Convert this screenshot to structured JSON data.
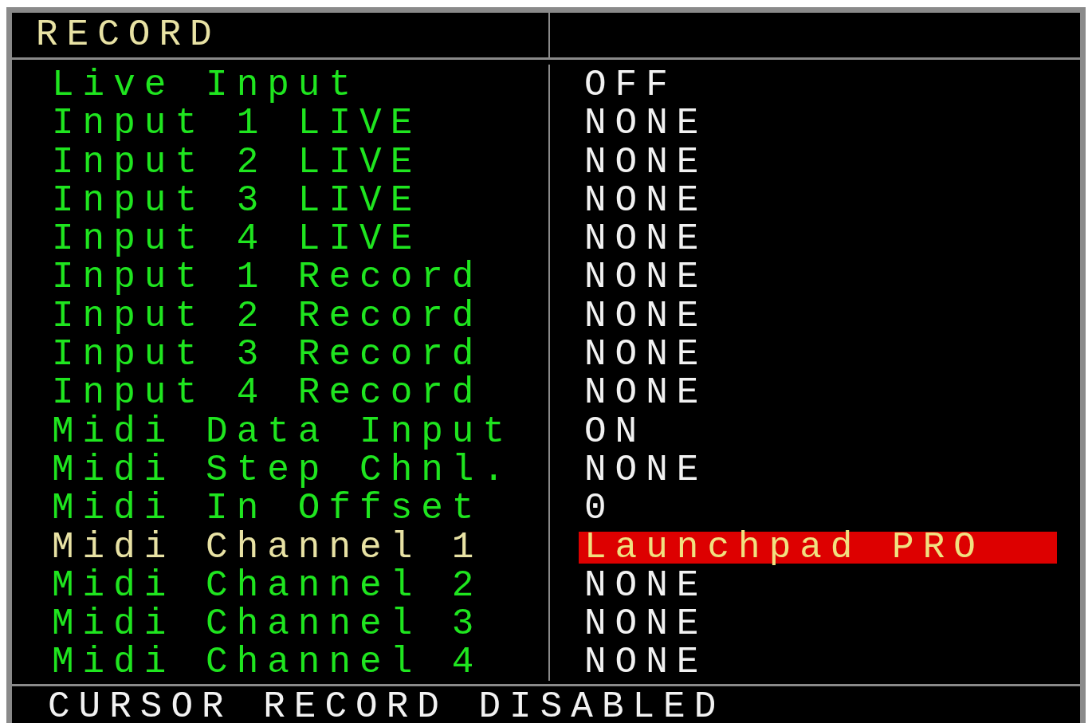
{
  "title": "RECORD",
  "rows": [
    {
      "label": "Live Input",
      "value": "OFF",
      "selected": false
    },
    {
      "label": "Input 1 LIVE",
      "value": "NONE",
      "selected": false
    },
    {
      "label": "Input 2 LIVE",
      "value": "NONE",
      "selected": false
    },
    {
      "label": "Input 3 LIVE",
      "value": "NONE",
      "selected": false
    },
    {
      "label": "Input 4 LIVE",
      "value": "NONE",
      "selected": false
    },
    {
      "label": "Input 1 Record",
      "value": "NONE",
      "selected": false
    },
    {
      "label": "Input 2 Record",
      "value": "NONE",
      "selected": false
    },
    {
      "label": "Input 3 Record",
      "value": "NONE",
      "selected": false
    },
    {
      "label": "Input 4 Record",
      "value": "NONE",
      "selected": false
    },
    {
      "label": "Midi Data Input",
      "value": "ON",
      "selected": false
    },
    {
      "label": "Midi Step Chnl.",
      "value": "NONE",
      "selected": false
    },
    {
      "label": "Midi In Offset",
      "value": "0",
      "selected": false
    },
    {
      "label": "Midi Channel 1",
      "value": "Launchpad PRO",
      "selected": true
    },
    {
      "label": "Midi Channel 2",
      "value": "NONE",
      "selected": false
    },
    {
      "label": "Midi Channel 3",
      "value": "NONE",
      "selected": false
    },
    {
      "label": "Midi Channel 4",
      "value": "NONE",
      "selected": false
    }
  ],
  "status_bar": "CURSOR RECORD DISABLED"
}
